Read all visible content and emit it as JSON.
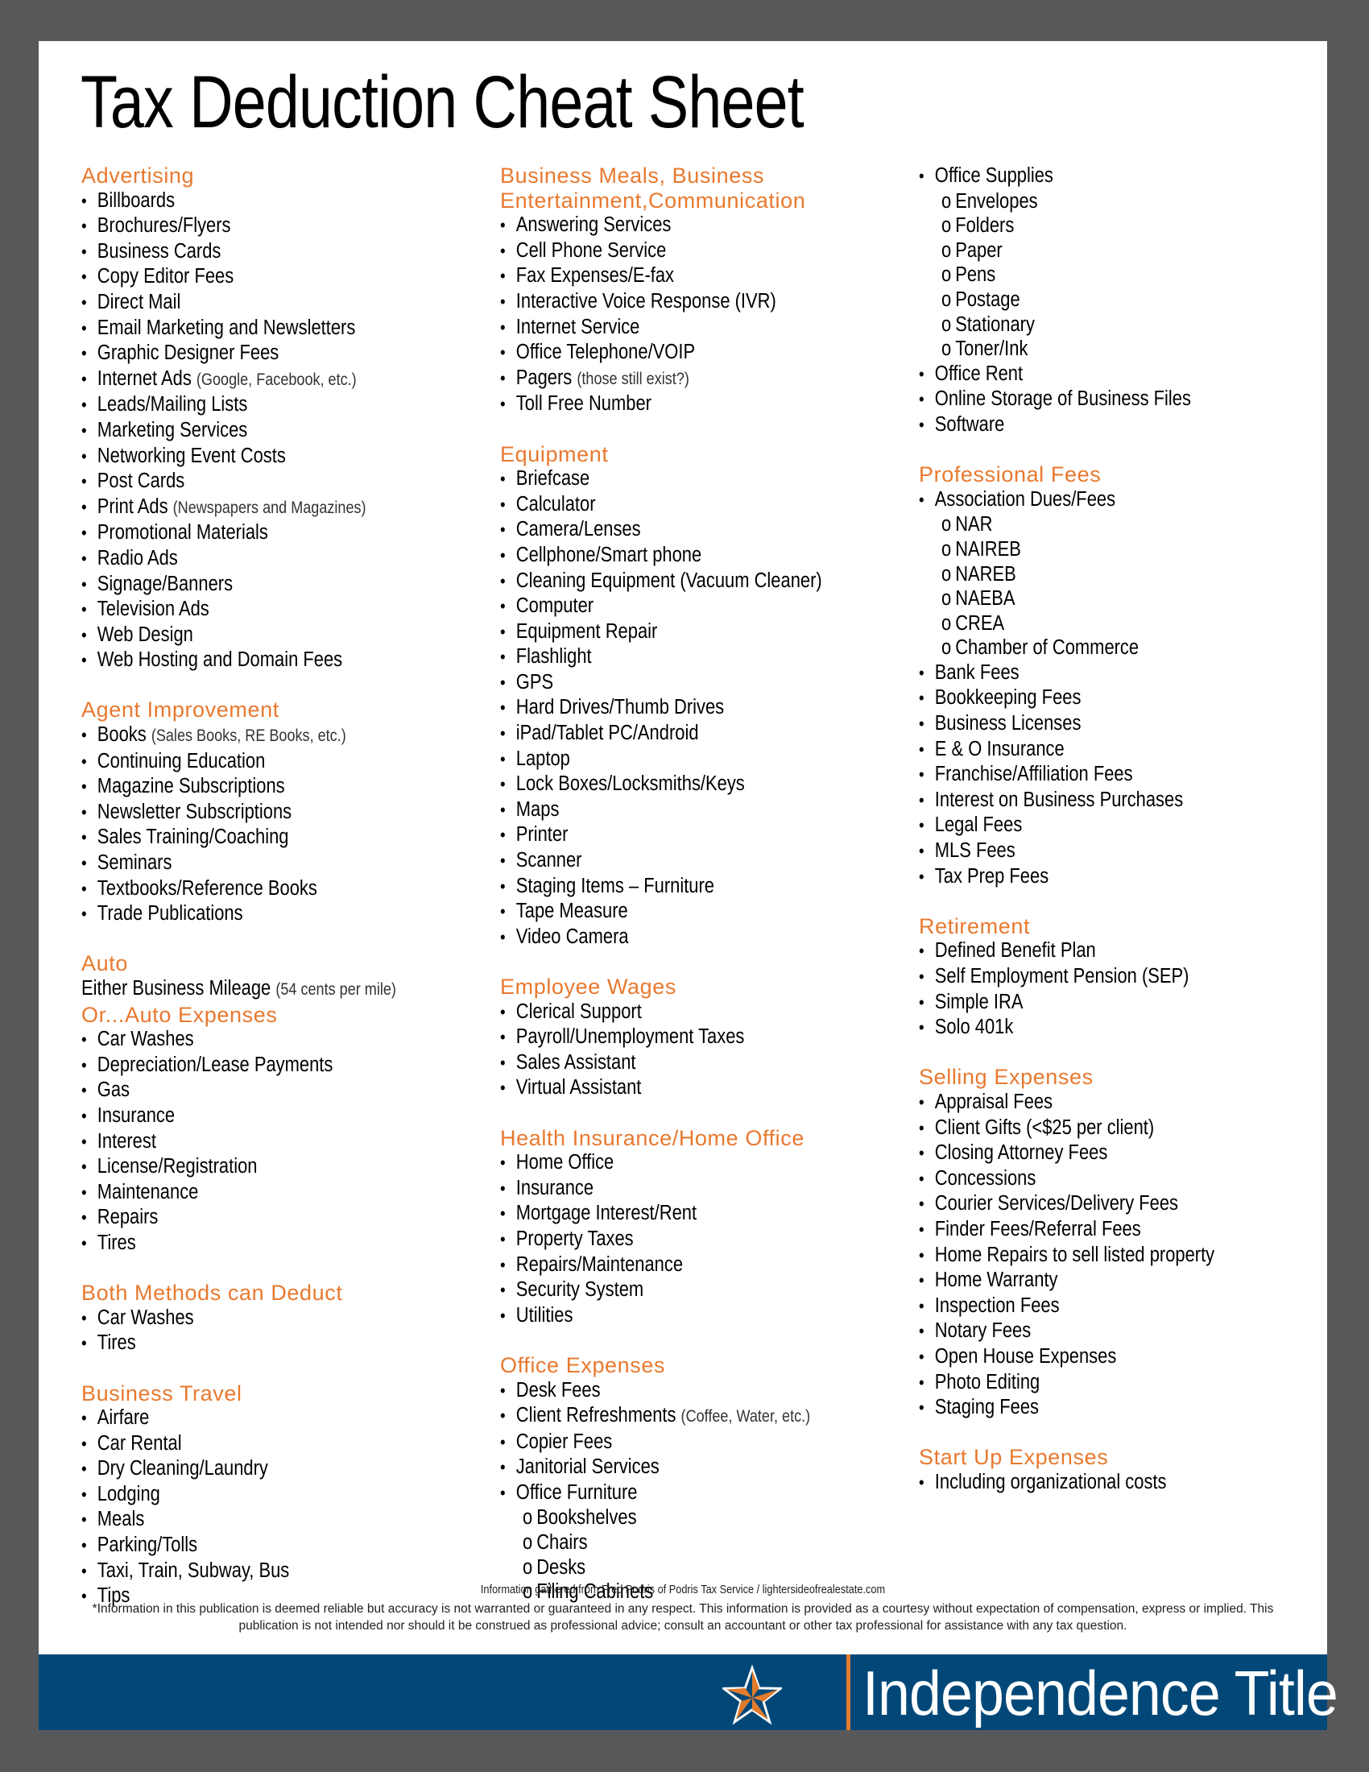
{
  "title": "Tax Deduction Cheat Sheet",
  "colors": {
    "heading": "#e8792f",
    "banner": "#014878",
    "accent": "#e17b2d",
    "frame": "#58585a"
  },
  "columns": [
    {
      "sections": [
        {
          "heading": "Advertising",
          "items": [
            {
              "text": "Billboards"
            },
            {
              "text": "Brochures/Flyers"
            },
            {
              "text": "Business Cards"
            },
            {
              "text": "Copy Editor Fees"
            },
            {
              "text": "Direct Mail"
            },
            {
              "text": "Email Marketing and Newsletters"
            },
            {
              "text": "Graphic Designer Fees"
            },
            {
              "text": "Internet Ads",
              "note": "(Google, Facebook, etc.)"
            },
            {
              "text": "Leads/Mailing Lists"
            },
            {
              "text": "Marketing Services"
            },
            {
              "text": "Networking Event Costs"
            },
            {
              "text": "Post Cards"
            },
            {
              "text": "Print Ads",
              "note": "(Newspapers and Magazines)"
            },
            {
              "text": "Promotional Materials"
            },
            {
              "text": "Radio Ads"
            },
            {
              "text": "Signage/Banners"
            },
            {
              "text": "Television Ads"
            },
            {
              "text": "Web Design"
            },
            {
              "text": "Web Hosting and Domain Fees"
            }
          ]
        },
        {
          "heading": "Agent Improvement",
          "items": [
            {
              "text": "Books",
              "note": "(Sales Books, RE Books, etc.)"
            },
            {
              "text": "Continuing Education"
            },
            {
              "text": "Magazine Subscriptions"
            },
            {
              "text": "Newsletter Subscriptions"
            },
            {
              "text": "Sales Training/Coaching"
            },
            {
              "text": "Seminars"
            },
            {
              "text": "Textbooks/Reference Books"
            },
            {
              "text": "Trade Publications"
            }
          ]
        },
        {
          "heading": "Auto",
          "items": [
            {
              "text": "Either Business Mileage",
              "note": "(54 cents per mile)",
              "plain": true
            },
            {
              "text": "Or...Auto Expenses",
              "heading": true
            },
            {
              "text": "Car Washes"
            },
            {
              "text": "Depreciation/Lease Payments"
            },
            {
              "text": "Gas"
            },
            {
              "text": "Insurance"
            },
            {
              "text": "Interest"
            },
            {
              "text": "License/Registration"
            },
            {
              "text": "Maintenance"
            },
            {
              "text": "Repairs"
            },
            {
              "text": "Tires"
            }
          ]
        },
        {
          "heading": "Both Methods can Deduct",
          "items": [
            {
              "text": "Car Washes"
            },
            {
              "text": "Tires"
            }
          ]
        },
        {
          "heading": "Business Travel",
          "items": [
            {
              "text": "Airfare"
            },
            {
              "text": "Car Rental"
            },
            {
              "text": "Dry Cleaning/Laundry"
            },
            {
              "text": "Lodging"
            },
            {
              "text": "Meals"
            },
            {
              "text": "Parking/Tolls"
            },
            {
              "text": "Taxi, Train, Subway, Bus"
            },
            {
              "text": "Tips"
            }
          ]
        }
      ]
    },
    {
      "sections": [
        {
          "heading": "Business Meals, Business",
          "heading2": "Entertainment,Communication",
          "items": [
            {
              "text": "Answering Services"
            },
            {
              "text": "Cell Phone Service"
            },
            {
              "text": "Fax Expenses/E-fax"
            },
            {
              "text": "Interactive Voice Response (IVR)"
            },
            {
              "text": "Internet Service"
            },
            {
              "text": "Office Telephone/VOIP"
            },
            {
              "text": "Pagers",
              "note": "(those still exist?)"
            },
            {
              "text": "Toll Free Number"
            }
          ]
        },
        {
          "heading": "Equipment",
          "items": [
            {
              "text": "Briefcase"
            },
            {
              "text": "Calculator"
            },
            {
              "text": "Camera/Lenses"
            },
            {
              "text": "Cellphone/Smart phone"
            },
            {
              "text": "Cleaning Equipment (Vacuum Cleaner)"
            },
            {
              "text": "Computer"
            },
            {
              "text": "Equipment Repair"
            },
            {
              "text": "Flashlight"
            },
            {
              "text": "GPS"
            },
            {
              "text": "Hard Drives/Thumb Drives"
            },
            {
              "text": "iPad/Tablet PC/Android"
            },
            {
              "text": "Laptop"
            },
            {
              "text": "Lock Boxes/Locksmiths/Keys"
            },
            {
              "text": "Maps"
            },
            {
              "text": "Printer"
            },
            {
              "text": "Scanner"
            },
            {
              "text": "Staging Items – Furniture"
            },
            {
              "text": "Tape Measure"
            },
            {
              "text": "Video Camera"
            }
          ]
        },
        {
          "heading": "Employee Wages",
          "items": [
            {
              "text": "Clerical Support"
            },
            {
              "text": "Payroll/Unemployment Taxes"
            },
            {
              "text": "Sales Assistant"
            },
            {
              "text": "Virtual Assistant"
            }
          ]
        },
        {
          "heading": "Health Insurance/Home Office",
          "items": [
            {
              "text": "Home Office"
            },
            {
              "text": "Insurance"
            },
            {
              "text": "Mortgage Interest/Rent"
            },
            {
              "text": "Property Taxes"
            },
            {
              "text": "Repairs/Maintenance"
            },
            {
              "text": "Security System"
            },
            {
              "text": "Utilities"
            }
          ]
        },
        {
          "heading": "Office Expenses",
          "items": [
            {
              "text": "Desk Fees"
            },
            {
              "text": "Client Refreshments",
              "note": "(Coffee, Water, etc.)"
            },
            {
              "text": "Copier Fees"
            },
            {
              "text": "Janitorial Services"
            },
            {
              "text": "Office Furniture",
              "sub": [
                "Bookshelves",
                "Chairs",
                "Desks",
                "Filing Cabinets"
              ]
            }
          ]
        }
      ]
    },
    {
      "sections": [
        {
          "heading": "",
          "items": [
            {
              "text": "Office Supplies",
              "sub": [
                "Envelopes",
                "Folders",
                "Paper",
                "Pens",
                "Postage",
                "Stationary",
                "Toner/Ink"
              ]
            },
            {
              "text": "Office Rent"
            },
            {
              "text": "Online Storage of Business Files"
            },
            {
              "text": "Software"
            }
          ]
        },
        {
          "heading": "Professional Fees",
          "items": [
            {
              "text": "Association Dues/Fees",
              "sub": [
                "NAR",
                "NAIREB",
                "NAREB",
                "NAEBA",
                "CREA",
                "Chamber of Commerce"
              ]
            },
            {
              "text": "Bank Fees"
            },
            {
              "text": "Bookkeeping Fees"
            },
            {
              "text": "Business Licenses"
            },
            {
              "text": "E & O Insurance"
            },
            {
              "text": "Franchise/Affiliation Fees"
            },
            {
              "text": "Interest on Business Purchases"
            },
            {
              "text": "Legal Fees"
            },
            {
              "text": "MLS Fees"
            },
            {
              "text": "Tax Prep Fees"
            }
          ]
        },
        {
          "heading": "Retirement",
          "items": [
            {
              "text": "Defined Benefit Plan"
            },
            {
              "text": "Self Employment Pension (SEP)"
            },
            {
              "text": "Simple IRA"
            },
            {
              "text": "Solo 401k"
            }
          ]
        },
        {
          "heading": "Selling Expenses",
          "items": [
            {
              "text": "Appraisal Fees"
            },
            {
              "text": "Client Gifts (<$25 per client)"
            },
            {
              "text": "Closing Attorney Fees"
            },
            {
              "text": "Concessions"
            },
            {
              "text": "Courier Services/Delivery Fees"
            },
            {
              "text": "Finder Fees/Referral Fees"
            },
            {
              "text": "Home Repairs to sell listed property"
            },
            {
              "text": "Home Warranty"
            },
            {
              "text": "Inspection Fees"
            },
            {
              "text": "Notary Fees"
            },
            {
              "text": "Open House Expenses"
            },
            {
              "text": "Photo Editing"
            },
            {
              "text": "Staging Fees"
            }
          ]
        },
        {
          "heading": "Start Up Expenses",
          "items": [
            {
              "text": "Including organizational costs"
            }
          ]
        }
      ]
    }
  ],
  "markers": {
    "bullet": "•",
    "sub": "o"
  },
  "footer": {
    "source": "Information gathered from Fred Podris of Podris Tax Service / lightersideofrealestate.com",
    "disclaimer": "*Information in this publication is deemed reliable but accuracy is not warranted or guaranteed in any respect. This information is provided as a courtesy without expectation of compensation, express or implied. This publication is not intended nor should it be construed as professional advice; consult an accountant or other tax professional for assistance with any tax question."
  },
  "brand": {
    "name": "Independence Title",
    "logo_icon": "nautical-star-icon"
  }
}
